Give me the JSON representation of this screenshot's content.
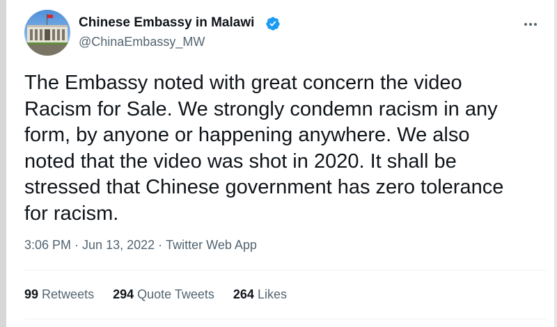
{
  "account": {
    "display_name": "Chinese Embassy in Malawi",
    "handle": "@ChinaEmbassy_MW",
    "verified": true,
    "verified_badge": "verified-badge-icon",
    "avatar": "embassy-building-avatar"
  },
  "tweet": {
    "lines": [
      "The Embassy noted with great concern the video",
      "Racism for Sale. We strongly condemn racism in any",
      "form, by anyone or happening anywhere. We also",
      "noted that the video was shot in 2020. It shall be",
      "stressed that Chinese government has zero tolerance",
      "for racism."
    ]
  },
  "meta": {
    "time": "3:06 PM",
    "separator": "·",
    "date": "Jun 13, 2022",
    "source": "Twitter Web App"
  },
  "stats": {
    "retweets": {
      "count": "99",
      "label": "Retweets"
    },
    "quote_tweets": {
      "count": "294",
      "label": "Quote Tweets"
    },
    "likes": {
      "count": "264",
      "label": "Likes"
    }
  },
  "menu_icon": "more-options-icon",
  "colors": {
    "primary_text": "#0f1419",
    "secondary_text": "#536471",
    "verified_blue": "#1d9bf0",
    "divider": "#eff3f4"
  }
}
